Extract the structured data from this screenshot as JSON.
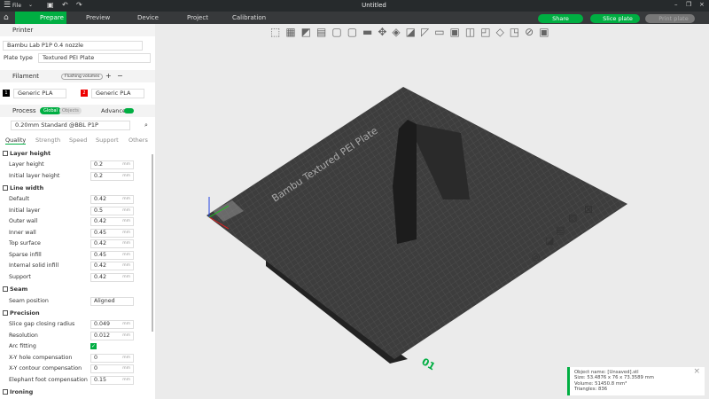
{
  "titlebar": {
    "menu": "File",
    "title": "Untitled"
  },
  "tabs": [
    {
      "label": "Prepare"
    },
    {
      "label": "Preview"
    },
    {
      "label": "Device"
    },
    {
      "label": "Project"
    },
    {
      "label": "Calibration"
    }
  ],
  "actions": {
    "share": "Share",
    "slice": "Slice plate",
    "print": "Print plate"
  },
  "printer": {
    "header": "Printer",
    "name": "Bambu Lab P1P 0.4 nozzle",
    "plate_label": "Plate type",
    "plate": "Textured PEI Plate"
  },
  "filament": {
    "header": "Filament",
    "flushing": "Flushing volumes",
    "items": [
      {
        "num": "1",
        "name": "Generic PLA",
        "color": "#000000"
      },
      {
        "num": "2",
        "name": "Generic PLA",
        "color": "#e00000"
      }
    ]
  },
  "process": {
    "header": "Process",
    "global": "Global",
    "objects": "Objects",
    "advance": "Advance",
    "preset": "0.20mm Standard @BBL P1P",
    "tabs": [
      "Quality",
      "Strength",
      "Speed",
      "Support",
      "Others"
    ]
  },
  "settings": [
    {
      "type": "head",
      "label": "Layer height"
    },
    {
      "label": "Layer height",
      "value": "0.2",
      "unit": "mm"
    },
    {
      "label": "Initial layer height",
      "value": "0.2",
      "unit": "mm"
    },
    {
      "type": "head",
      "label": "Line width"
    },
    {
      "label": "Default",
      "value": "0.42",
      "unit": "mm"
    },
    {
      "label": "Initial layer",
      "value": "0.5",
      "unit": "mm"
    },
    {
      "label": "Outer wall",
      "value": "0.42",
      "unit": "mm"
    },
    {
      "label": "Inner wall",
      "value": "0.45",
      "unit": "mm"
    },
    {
      "label": "Top surface",
      "value": "0.42",
      "unit": "mm"
    },
    {
      "label": "Sparse infill",
      "value": "0.45",
      "unit": "mm"
    },
    {
      "label": "Internal solid infill",
      "value": "0.42",
      "unit": "mm"
    },
    {
      "label": "Support",
      "value": "0.42",
      "unit": "mm"
    },
    {
      "type": "head",
      "label": "Seam"
    },
    {
      "label": "Seam position",
      "value": "Aligned",
      "unit": ""
    },
    {
      "type": "head",
      "label": "Precision"
    },
    {
      "label": "Slice gap closing radius",
      "value": "0.049",
      "unit": "mm"
    },
    {
      "label": "Resolution",
      "value": "0.012",
      "unit": "mm"
    },
    {
      "label": "Arc fitting",
      "type": "check"
    },
    {
      "label": "X-Y hole compensation",
      "value": "0",
      "unit": "mm"
    },
    {
      "label": "X-Y contour compensation",
      "value": "0",
      "unit": "mm"
    },
    {
      "label": "Elephant foot compensation",
      "value": "0.15",
      "unit": "mm"
    },
    {
      "type": "head",
      "label": "Ironing"
    }
  ],
  "plate": {
    "label": "Bambu Textured PEI Plate",
    "number": "01"
  },
  "object_info": {
    "name": "Object name: [Unsaved].stl",
    "size": "Size: 53.4876 x 76 x 73.3589 mm",
    "volume": "Volume: 51450.8 mm³",
    "triangles": "Triangles: 836"
  }
}
